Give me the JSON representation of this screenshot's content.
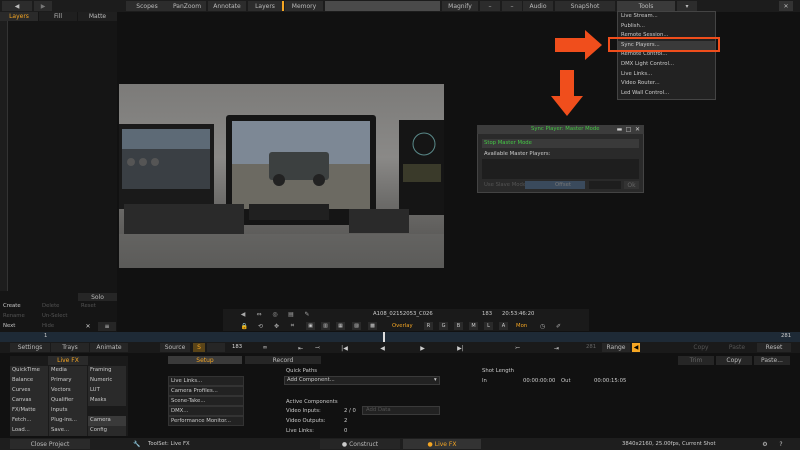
{
  "topbar": {
    "scopes": "Scopes",
    "panzoom": "PanZoom",
    "annotate": "Annotate",
    "layers": "Layers",
    "memory": "Memory",
    "magnify": "Magnify",
    "audio": "Audio",
    "snapshot": "SnapShot",
    "tools": "Tools"
  },
  "tools_menu": {
    "items": [
      "Live Stream...",
      "Publish...",
      "Remote Session...",
      "Sync Players...",
      "Remote Control...",
      "DMX Light Control...",
      "Live Links...",
      "Video Router...",
      "Led Wall Control..."
    ],
    "highlighted": "Sync Players..."
  },
  "left_panel": {
    "tabs": [
      "Layers",
      "Fill",
      "Matte"
    ],
    "solo": "Solo",
    "create": "Create",
    "delete": "Delete",
    "reset": "Reset",
    "rename": "Rename",
    "unselect": "Un-Select",
    "next": "Next",
    "hide": "Hide",
    "close": "✕"
  },
  "sync_dialog": {
    "title": "Sync Player: Master Mode",
    "stop": "Stop Master Mode",
    "available": "Available Master Players:",
    "use_slave": "Use Slave Mode",
    "offset": "Offset",
    "ok": "Ok"
  },
  "info_bar": {
    "filename": "A108_02152053_C026",
    "frames": "183",
    "timecode": "20:53:46:20",
    "overlay": "Overlay",
    "channels": [
      "R",
      "G",
      "B",
      "M",
      "L",
      "A"
    ],
    "mon": "Mon"
  },
  "timeline": {
    "frame": "1",
    "end": "281"
  },
  "transport": {
    "settings": "Settings",
    "trays": "Trays",
    "animate": "Animate",
    "source": "Source",
    "s": "S",
    "current": "183",
    "end_frame": "281",
    "range": "Range",
    "copy": "Copy",
    "paste": "Paste",
    "reset": "Reset",
    "trim": "Trim",
    "copy2": "Copy",
    "paste2": "Paste..."
  },
  "tools_grid": {
    "title": "Live FX",
    "items": [
      [
        "QuickTime",
        "Media",
        "Framing"
      ],
      [
        "Balance",
        "Primary",
        "Numeric"
      ],
      [
        "Curves",
        "Vectors",
        "LUT"
      ],
      [
        "Canvas",
        "Qualifier",
        "Masks"
      ],
      [
        "FX/Matte",
        "Inputs",
        ""
      ],
      [
        "Fetch...",
        "Plug-ins...",
        "Camera"
      ],
      [
        "Load...",
        "Save...",
        "Config"
      ]
    ]
  },
  "setup": {
    "tabs": [
      "Setup",
      "Record"
    ],
    "buttons": [
      "Live Links...",
      "Camera Profiles...",
      "Scene-Take...",
      "DMX...",
      "Performance Monitor..."
    ],
    "quick_paths": "Quick Paths",
    "add_component": "Add Component...",
    "shot_length": "Shot Length",
    "in": "In",
    "in_tc": "00:00:00:00",
    "out": "Out",
    "out_tc": "00:00:15:05",
    "active_components": "Active Components",
    "video_inputs": "Video Inputs:",
    "video_inputs_val": "2 / 0",
    "video_outputs": "Video Outputs:",
    "video_outputs_val": "2",
    "live_links": "Live Links:",
    "live_links_val": "0",
    "add_data": "Add Data"
  },
  "statusbar": {
    "close_project": "Close Project",
    "toolset": "ToolSet: Live FX",
    "construct": "Construct",
    "livefx": "Live FX",
    "info": "3840x2160, 25.00fps, Current Shot"
  },
  "colors": {
    "accent": "#f5a623",
    "arrow": "#f04e1c",
    "highlight_border": "#f04e1c",
    "dialog_title": "#45c845"
  }
}
